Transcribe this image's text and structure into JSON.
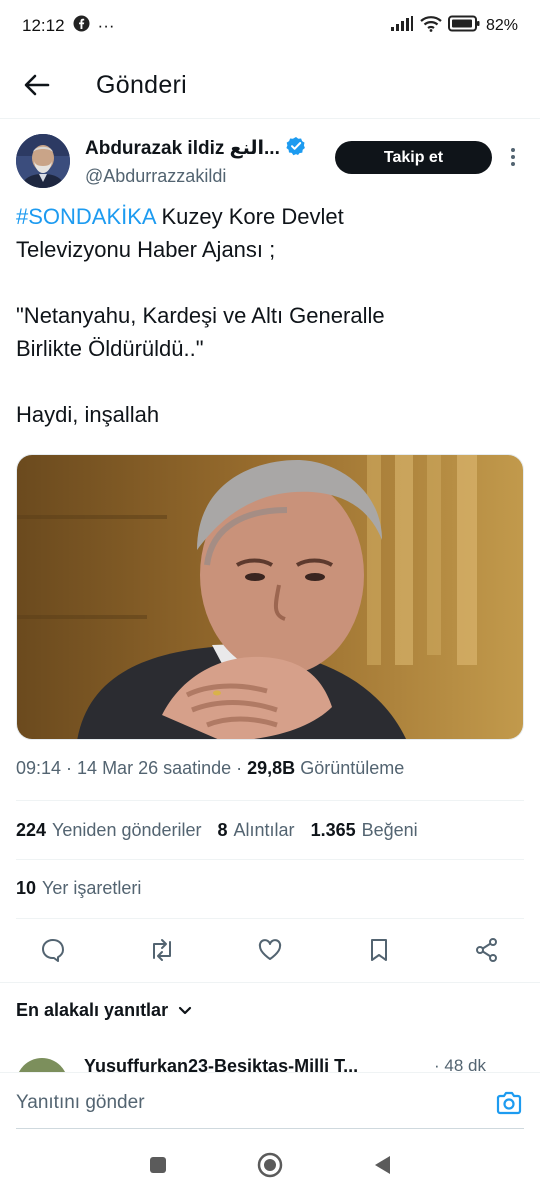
{
  "status_bar": {
    "time": "12:12",
    "dots": "···",
    "battery": "82%"
  },
  "header": {
    "title": "Gönderi"
  },
  "author": {
    "name": "Abdurazak ildiz النع...",
    "handle": "@Abdurrazzakildi",
    "follow_label": "Takip et"
  },
  "tweet": {
    "hashtag": "#SONDAKİKA",
    "line1_rest": " Kuzey Kore Devlet",
    "line2": "Televizyonu Haber Ajansı ;",
    "line3": "\"Netanyahu, Kardeşi ve Altı Generalle",
    "line4": "Birlikte Öldürüldü..\"",
    "line5": "Haydi, inşallah"
  },
  "meta": {
    "timestamp": "09:14 · 14 Mar 26 saatinde · ",
    "views_count": "29,8B",
    "views_label": " Görüntüleme"
  },
  "stats": {
    "reposts_count": "224",
    "reposts_label": "Yeniden gönderiler",
    "quotes_count": "8",
    "quotes_label": "Alıntılar",
    "likes_count": "1.365",
    "likes_label": "Beğeni",
    "bookmarks_count": "10",
    "bookmarks_label": "Yer işaretleri"
  },
  "replies": {
    "sort_label": "En alakalı yanıtlar",
    "first_reply_name": "Yusuffurkan23-Besiktas-Milli T...",
    "first_reply_time": "· 48 dk"
  },
  "compose": {
    "placeholder": "Yanıtını gönder"
  },
  "colors": {
    "accent": "#1d9bf0",
    "text": "#0f1419",
    "secondary": "#536471"
  }
}
